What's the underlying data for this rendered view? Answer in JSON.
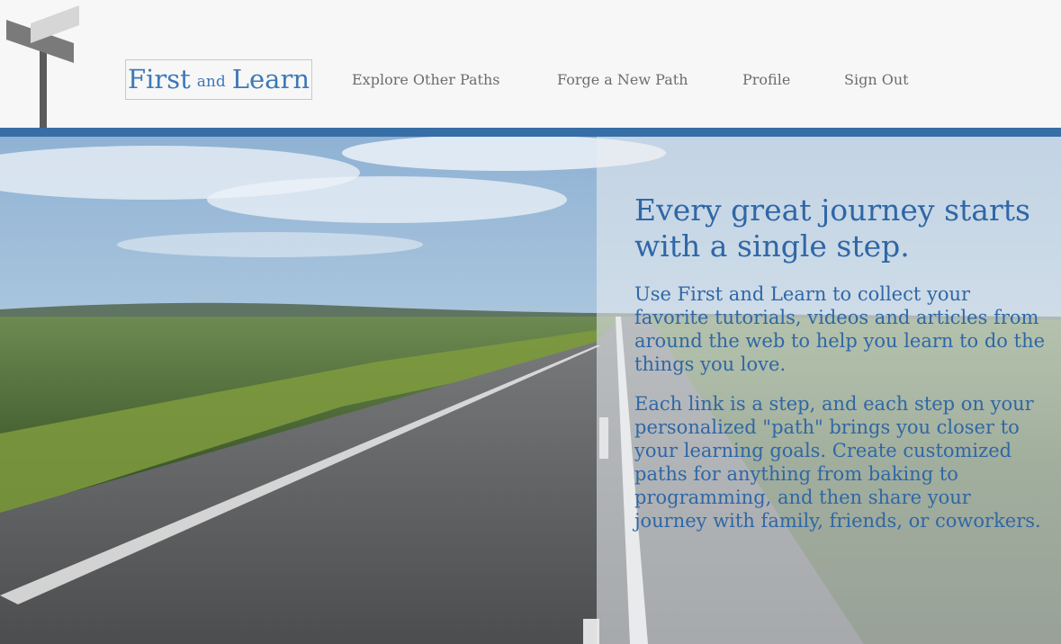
{
  "header": {
    "logo": {
      "first": "First",
      "and": "and",
      "learn": "Learn"
    },
    "nav": [
      {
        "label": "Explore Other Paths"
      },
      {
        "label": "Forge a New Path"
      },
      {
        "label": "Profile"
      },
      {
        "label": "Sign Out"
      }
    ],
    "accent_color": "#386ea6",
    "signpost_icon": "street-sign-icon"
  },
  "hero": {
    "background_image": "open-road-landscape",
    "heading": "Every great journey starts with a single step.",
    "paragraphs": [
      "Use First and Learn to collect your favorite tutorials, videos and articles from around the web to help you learn to do the things you love.",
      "Each link is a step, and each step on your personalized \"path\" brings you closer to your learning goals. Create customized paths for anything from baking to programming, and then share your journey with family, friends, or coworkers."
    ],
    "text_color": "#2f67a6"
  }
}
